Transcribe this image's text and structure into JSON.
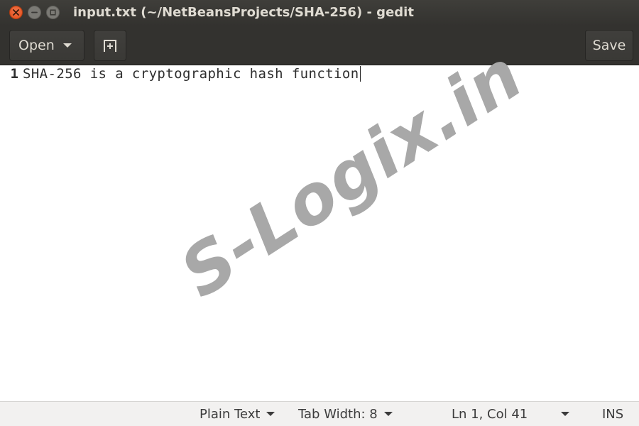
{
  "window": {
    "title": "input.txt (~/NetBeansProjects/SHA-256) - gedit"
  },
  "headerbar": {
    "open_label": "Open",
    "save_label": "Save",
    "new_tab_icon": "new-tab-icon"
  },
  "editor": {
    "lines": [
      {
        "number": "1",
        "text": "SHA-256 is a cryptographic hash function"
      }
    ]
  },
  "watermark": "S-Logix.in",
  "statusbar": {
    "language": "Plain Text",
    "tab_width": "Tab Width: 8",
    "position": "Ln 1, Col 41",
    "mode": "INS"
  },
  "colors": {
    "titlebar": "#3c3b37",
    "close_button": "#e95420",
    "statusbar": "#f2f1f0",
    "watermark": "#a8a8a8"
  }
}
